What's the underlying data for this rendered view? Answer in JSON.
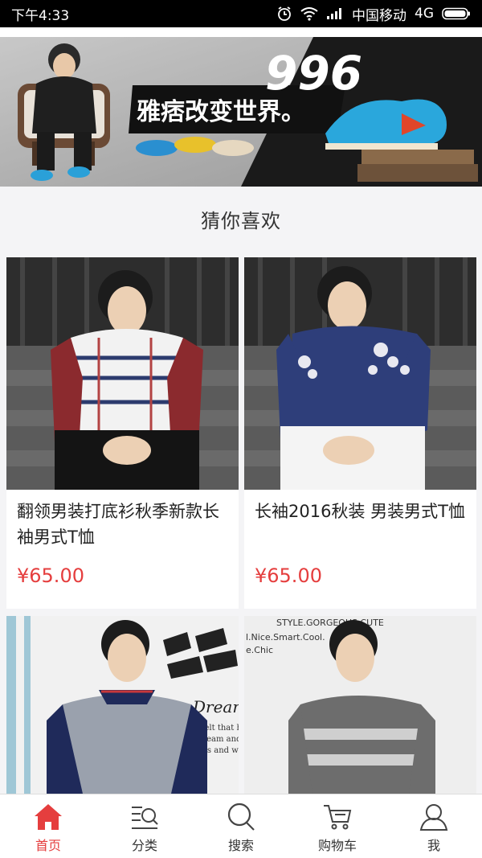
{
  "status_bar": {
    "time": "下午4:33",
    "carrier": "中国移动",
    "network": "4G"
  },
  "banner": {
    "number": "996",
    "slogan": "雅痞改变世界。"
  },
  "section": {
    "title": "猜你喜欢"
  },
  "products": [
    {
      "name": "翻领男装打底衫秋季新款长袖男式T恤",
      "price": "¥65.00"
    },
    {
      "name": "长袖2016秋装 男装男式T恤",
      "price": "¥65.00"
    }
  ],
  "poster_text": {
    "dreams": "Dreams",
    "line1": "He felt that his life",
    "line2": "of dream and he s",
    "line3": "it was and wheth",
    "top_line": "STYLE.GORGEOUS.CUTE",
    "mid_line": "l.Nice.Smart.Cool.",
    "low_line": "e.Chic"
  },
  "nav": {
    "items": [
      {
        "label": "首页",
        "icon": "home-icon",
        "active": true
      },
      {
        "label": "分类",
        "icon": "category-icon",
        "active": false
      },
      {
        "label": "搜索",
        "icon": "search-icon",
        "active": false
      },
      {
        "label": "购物车",
        "icon": "cart-icon",
        "active": false
      },
      {
        "label": "我",
        "icon": "user-icon",
        "active": false
      }
    ]
  },
  "colors": {
    "accent": "#e53e3e",
    "background": "#f4f4f6"
  }
}
